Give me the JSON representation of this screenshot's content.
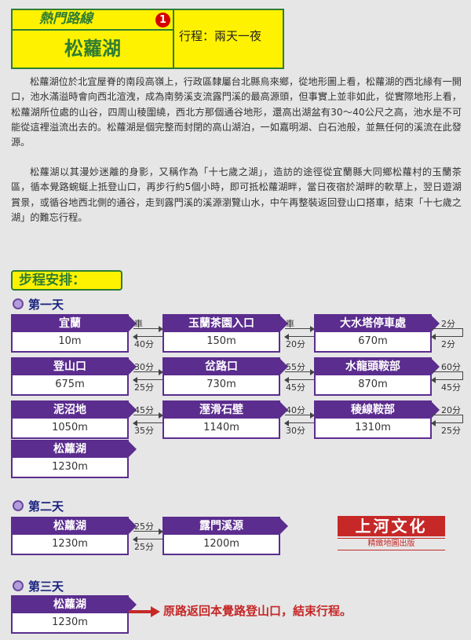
{
  "header": {
    "category": "熱門路線",
    "number": "1",
    "lake_name": "松蘿湖",
    "trip_length": "行程：兩天一夜"
  },
  "intro": {
    "paragraph1": "松蘿湖位於北宜屋脊的南段高嶺上，行政區隸屬台北縣烏來鄉，從地形圖上看，松蘿湖的西北緣有一開口，池水滿溢時會向西北渲洩，成為南勢溪支流露門溪的最高源頭，但事實上並非如此，從實際地形上看，松蘿湖所位處的山谷，四周山稜圍繞，西北方那個通谷地形，還高出湖盆有30～40公尺之高，池水是不可能從這裡溢流出去的。松蘿湖是個完整而封閉的高山湖泊，一如嘉明湖、白石池般，並無任何的溪流在此發源。",
    "paragraph2": "松蘿湖以其漫妙迷離的身影，又稱作為「十七歲之湖」，造訪的途徑從宜蘭縣大同鄉松蘿村的玉蘭茶區，循本覺路蜿蜒上抵登山口，再步行約5個小時，即可抵松蘿湖畔，當日夜宿於湖畔的軟草上，翌日遊湖賞景，或循谷地西北側的通谷，走到露門溪的溪源瀏覽山水，中午再整裝返回登山口搭車，結束「十七歲之湖」的難忘行程。"
  },
  "schedule": {
    "heading": "步程安排：",
    "day1": {
      "label": "第一天",
      "stops": [
        {
          "name": "宜蘭",
          "elev": "10m"
        },
        {
          "name": "玉蘭茶園入口",
          "elev": "150m"
        },
        {
          "name": "大水塔停車處",
          "elev": "670m"
        },
        {
          "name": "登山口",
          "elev": "675m"
        },
        {
          "name": "岔路口",
          "elev": "730m"
        },
        {
          "name": "水龍頭鞍部",
          "elev": "870m"
        },
        {
          "name": "泥沼地",
          "elev": "1050m"
        },
        {
          "name": "溼滑石壁",
          "elev": "1140m"
        },
        {
          "name": "稜線鞍部",
          "elev": "1310m"
        },
        {
          "name": "松蘿湖",
          "elev": "1230m"
        }
      ],
      "links": [
        {
          "fwd": "車",
          "back": "40分"
        },
        {
          "fwd": "車",
          "back": "20分"
        },
        {
          "fwd": "2分",
          "back": "2分"
        },
        {
          "fwd": "30分",
          "back": "25分"
        },
        {
          "fwd": "55分",
          "back": "45分"
        },
        {
          "fwd": "60分",
          "back": "45分"
        },
        {
          "fwd": "45分",
          "back": "35分"
        },
        {
          "fwd": "40分",
          "back": "30分"
        },
        {
          "fwd": "20分",
          "back": "25分"
        }
      ]
    },
    "day2": {
      "label": "第二天",
      "stops": [
        {
          "name": "松蘿湖",
          "elev": "1230m"
        },
        {
          "name": "露門溪源",
          "elev": "1200m"
        }
      ],
      "links": [
        {
          "fwd": "25分",
          "back": "25分"
        }
      ]
    },
    "day3": {
      "label": "第三天",
      "stops": [
        {
          "name": "松蘿湖",
          "elev": "1230m"
        }
      ],
      "note": "原路返回本覺路登山口，結束行程。"
    }
  },
  "logo": {
    "title": "上河文化",
    "subtitle": "精緻地圖出版"
  },
  "colors": {
    "header_yellow": "#fff200",
    "header_green": "#2e7d32",
    "box_purple": "#5b2d8e",
    "accent_red": "#c62828",
    "background": "#e6e6e6"
  }
}
